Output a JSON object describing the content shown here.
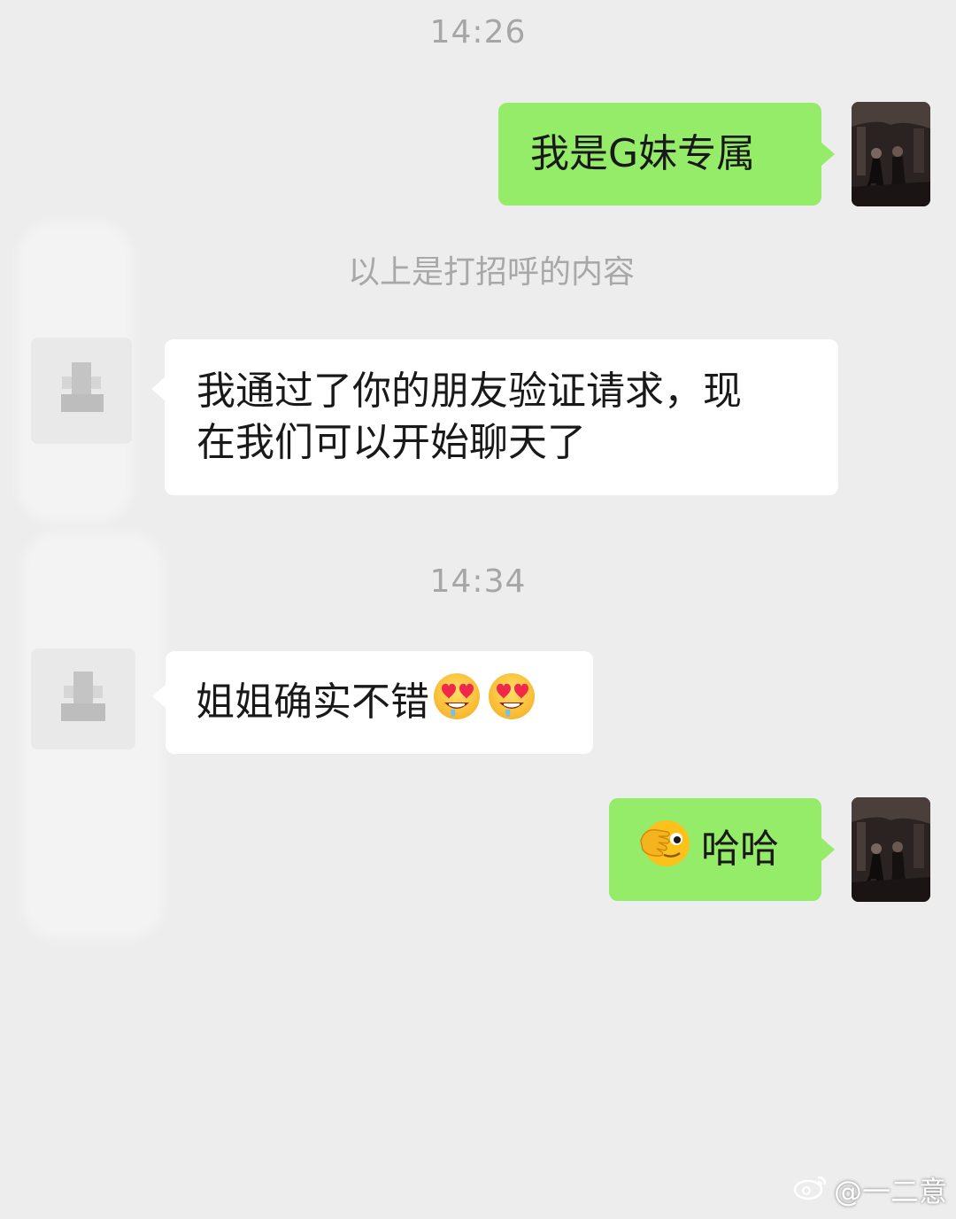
{
  "chat": {
    "messages": [
      {
        "type": "timestamp",
        "text": "14:26"
      },
      {
        "type": "outgoing",
        "text": "我是G妹专属"
      },
      {
        "type": "system",
        "text": "以上是打招呼的内容"
      },
      {
        "type": "incoming",
        "line1": "我通过了你的朋友验证请求，现",
        "line2": "在我们可以开始聊天了"
      },
      {
        "type": "timestamp",
        "text": "14:34"
      },
      {
        "type": "incoming",
        "text": "姐姐确实不错",
        "emojis": [
          "heart-eyes-drooling-emoji",
          "heart-eyes-drooling-emoji"
        ]
      },
      {
        "type": "outgoing",
        "emoji": "face-with-hand-over-eye-emoji",
        "text": "哈哈"
      }
    ]
  },
  "watermark": {
    "text": "@一二意",
    "icon": "weibo-icon"
  },
  "colors": {
    "background": "#ededed",
    "outgoing_bubble": "#95ec69",
    "incoming_bubble": "#ffffff",
    "timestamp_text": "#a6a6a6"
  }
}
